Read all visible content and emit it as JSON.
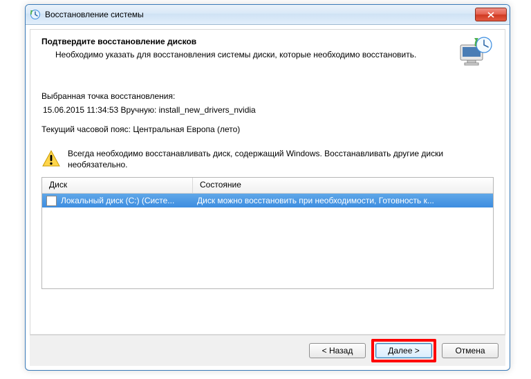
{
  "window": {
    "title": "Восстановление системы"
  },
  "header": {
    "heading": "Подтвердите восстановление дисков",
    "sub": "Необходимо указать для восстановления системы диски, которые необходимо восстановить."
  },
  "info": {
    "point_label": "Выбранная точка восстановления:",
    "point_value": "15.06.2015 11:34:53 Вручную: install_new_drivers_nvidia",
    "tz_line": "Текущий часовой пояс: Центральная Европа (лето)"
  },
  "warning": {
    "text": "Всегда необходимо восстанавливать диск, содержащий Windows. Восстанавливать другие диски необязательно."
  },
  "table": {
    "columns": {
      "disk": "Диск",
      "state": "Состояние"
    },
    "rows": [
      {
        "disk": "Локальный диск (C:) (Систе...",
        "state": "Диск можно восстановить при необходимости, Готовность к...",
        "checked": false,
        "selected": true
      }
    ]
  },
  "buttons": {
    "back": "< Назад",
    "next": "Далее >",
    "cancel": "Отмена"
  }
}
